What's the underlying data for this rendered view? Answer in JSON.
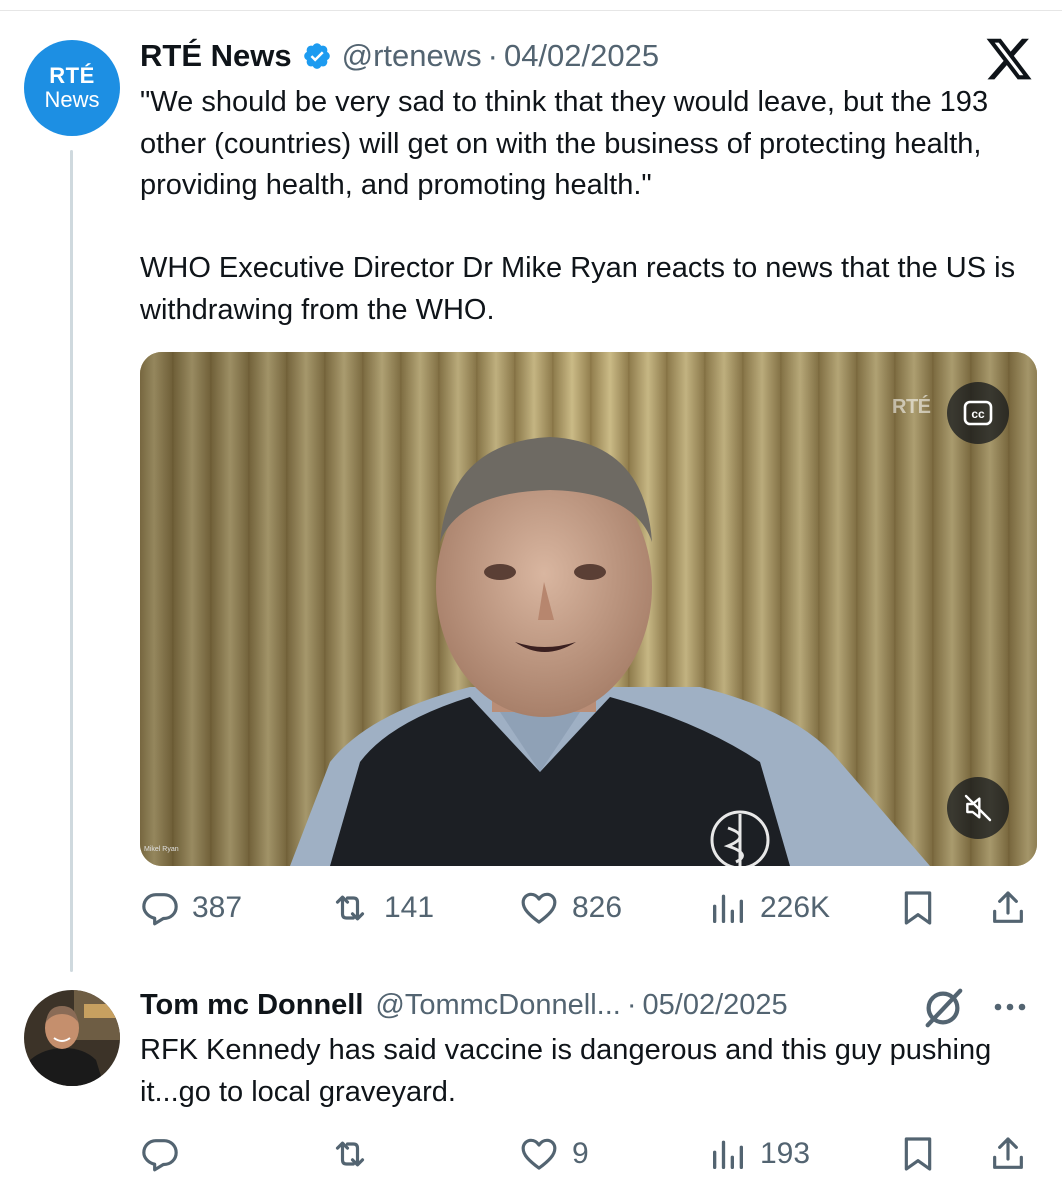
{
  "main_tweet": {
    "avatar": {
      "line1": "RTÉ",
      "line2": "News"
    },
    "display_name": "RTÉ News",
    "handle": "@rtenews",
    "separator": "·",
    "date": "04/02/2025",
    "text_paragraph_1": "\"We should be very sad to think that they would leave, but the 193 other (countries) will get on with the business of protecting health, providing health, and promoting health.\"",
    "text_paragraph_2": "WHO Executive Director Dr Mike Ryan reacts to news that the US is withdrawing from the WHO.",
    "media": {
      "watermark": "RTÉ",
      "caption_tag": "Mikel Ryan",
      "cc_icon": "closed-captions-icon",
      "mute_icon": "muted-speaker-icon"
    },
    "actions": {
      "replies": "387",
      "reposts": "141",
      "likes": "826",
      "views": "226K"
    }
  },
  "reply_tweet": {
    "display_name": "Tom mc Donnell",
    "handle": "@TommcDonnell...",
    "separator": "·",
    "date": "05/02/2025",
    "text": "RFK Kennedy has said vaccine is dangerous and this guy pushing it...go to local graveyard.",
    "actions": {
      "replies": "",
      "reposts": "",
      "likes": "9",
      "views": "193"
    }
  },
  "colors": {
    "verified_blue": "#1d9bf0",
    "avatar_blue": "#1d8fe3",
    "muted_text": "#536471",
    "primary_text": "#0f1419"
  }
}
